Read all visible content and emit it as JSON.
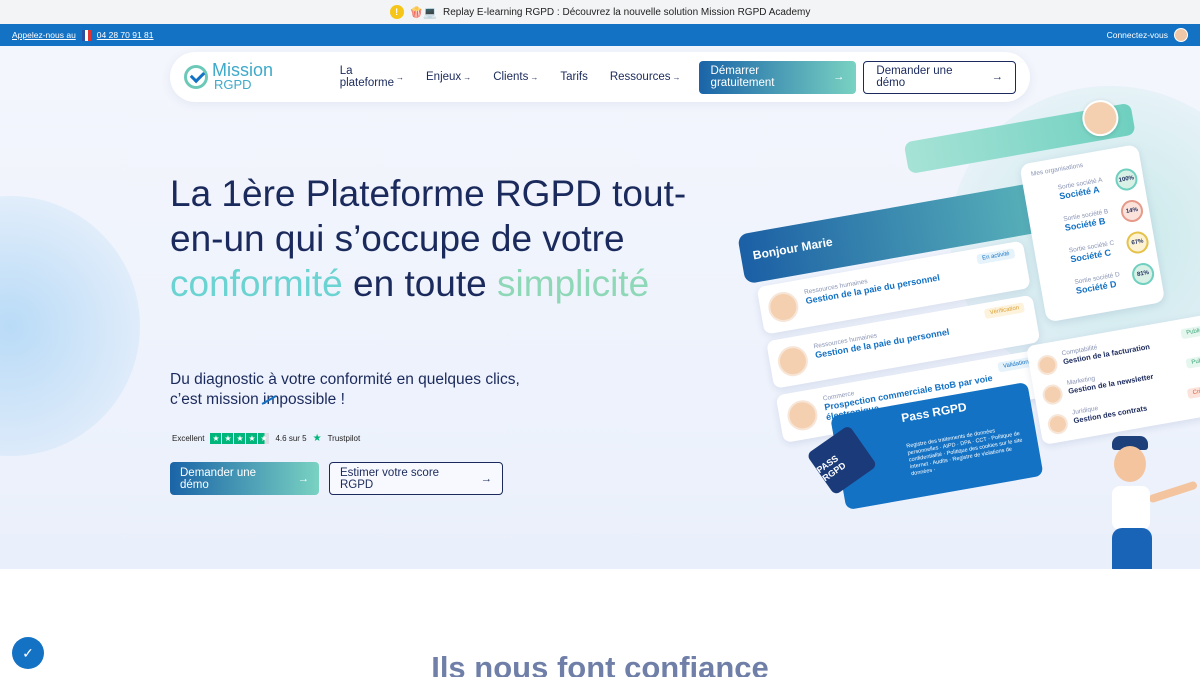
{
  "announcement": {
    "text": "Replay E-learning RGPD : Découvrez la nouvelle solution Mission RGPD Academy",
    "icon_left": "!",
    "icon_emoji": "🍿💻"
  },
  "contact_bar": {
    "call_label": "Appelez-nous au",
    "phone": "04 28 70 91 81",
    "login_label": "Connectez-vous"
  },
  "nav": {
    "logo_line1": "Mission",
    "logo_line2": "RGPD",
    "items": [
      {
        "label": "La plateforme",
        "arrow": "→"
      },
      {
        "label": "Enjeux",
        "arrow": "→"
      },
      {
        "label": "Clients",
        "arrow": "→"
      },
      {
        "label": "Tarifs",
        "arrow": ""
      },
      {
        "label": "Ressources",
        "arrow": "→"
      }
    ],
    "start_label": "Démarrer gratuitement",
    "demo_label": "Demander une démo",
    "arrow": "→"
  },
  "hero": {
    "title_part1": "La 1ère Plateforme RGPD tout-en-un qui s’occupe de votre ",
    "title_highlight1": "conformité",
    "title_part2": " en toute ",
    "title_highlight2": "simplicité",
    "subtitle_line1": "Du diagnostic à votre conformité en quelques clics,",
    "subtitle_line2_a": "c’est mission ",
    "subtitle_line2_strike": "i",
    "subtitle_line2_b": "mpossible !",
    "trust_excellent": "Excellent",
    "trust_score": "4.6 sur 5",
    "trust_brand": "Trustpilot",
    "cta_demo": "Demander une démo",
    "cta_score": "Estimer votre score RGPD",
    "arrow": "→"
  },
  "dashboard": {
    "greeting": "Bonjour Marie",
    "tasks": [
      {
        "category": "Ressources humaines",
        "title": "Gestion de la paie du personnel",
        "status": "En activité"
      },
      {
        "category": "Ressources humaines",
        "title": "Gestion de la paie du personnel",
        "status": "Vérification"
      },
      {
        "category": "Commerce",
        "title": "Prospection commerciale BtoB par voie électronique",
        "status": "Validation"
      }
    ],
    "orgs_title": "Mes organisations",
    "orgs": [
      {
        "sub": "Sortie société A",
        "name": "Société A",
        "score": "100%"
      },
      {
        "sub": "Sortie société B",
        "name": "Société B",
        "score": "14%"
      },
      {
        "sub": "Sortie société C",
        "name": "Société C",
        "score": "67%"
      },
      {
        "sub": "Sortie société D",
        "name": "Société D",
        "score": "81%"
      }
    ],
    "small_tasks": [
      {
        "category": "Comptabilité",
        "title": "Gestion de la facturation",
        "status": "Publié"
      },
      {
        "category": "Marketing",
        "title": "Gestion de la newsletter",
        "status": "Publié"
      },
      {
        "category": "Juridique",
        "title": "Gestion des contrats",
        "status": "Critique"
      }
    ],
    "pass_title": "Pass RGPD",
    "pass_desc": "Registre des traitements de données personnelles · AIPD · DPA · CCT · Politique de confidentialité · Politique des cookies sur le site internet · Audits · Registre de violations de données ·",
    "pass_badge": "PASS RGPD"
  },
  "lower": {
    "trusted_title": "Ils nous font confiance"
  },
  "colors": {
    "primary": "#1472c4",
    "navy": "#1b2a5c",
    "teal": "#6bd3d1",
    "green": "#8ed8b8"
  }
}
